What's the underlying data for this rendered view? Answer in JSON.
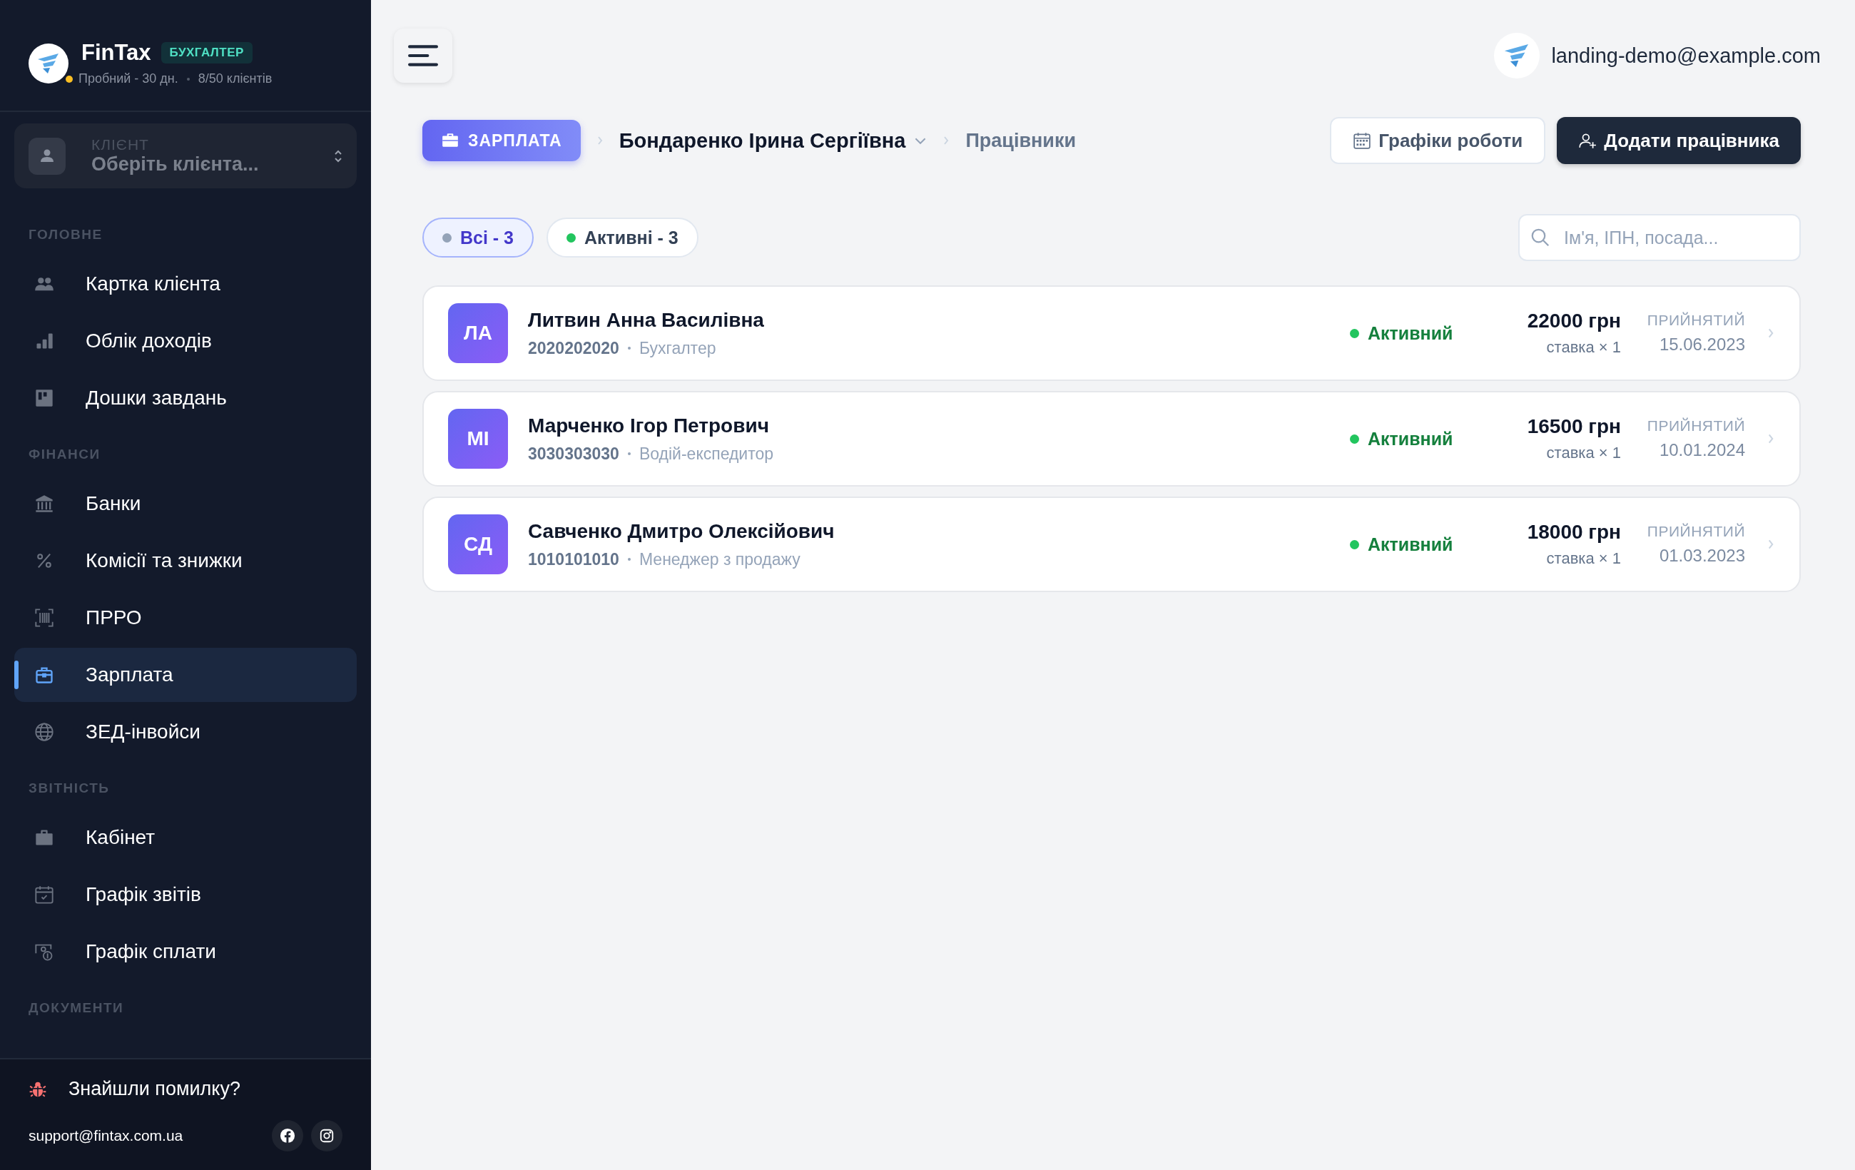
{
  "sidebar": {
    "brand": {
      "name": "FinTax",
      "badge": "БУХГАЛТЕР",
      "plan": "Пробний - 30 дн.",
      "clients": "8/50 клієнтів"
    },
    "client_select": {
      "label": "КЛІЄНТ",
      "placeholder": "Оберіть клієнта..."
    },
    "sections": [
      {
        "title": "ГОЛОВНЕ",
        "items": [
          {
            "label": "Картка клієнта",
            "selected": false
          },
          {
            "label": "Облік доходів",
            "selected": false
          },
          {
            "label": "Дошки завдань",
            "selected": false
          }
        ]
      },
      {
        "title": "ФІНАНСИ",
        "items": [
          {
            "label": "Банки",
            "selected": false
          },
          {
            "label": "Комісії та знижки",
            "selected": false
          },
          {
            "label": "ПРРО",
            "selected": false
          },
          {
            "label": "Зарплата",
            "selected": true
          },
          {
            "label": "ЗЕД-інвойси",
            "selected": false
          }
        ]
      },
      {
        "title": "ЗВІТНІСТЬ",
        "items": [
          {
            "label": "Кабінет",
            "selected": false
          },
          {
            "label": "Графік звітів",
            "selected": false
          },
          {
            "label": "Графік сплати",
            "selected": false
          }
        ]
      },
      {
        "title": "ДОКУМЕНТИ"
      }
    ],
    "footer": {
      "bug_report": "Знайшли помилку?",
      "email": "support@fintax.com.ua"
    }
  },
  "topbar": {
    "user_email": "landing-demo@example.com"
  },
  "breadcrumb": [
    {
      "label": "ЗАРПЛАТА",
      "kind": "module"
    },
    {
      "label": "Бондаренко Ірина Сергіївна",
      "kind": "dropdown"
    },
    {
      "label": "Працівники",
      "kind": "text"
    }
  ],
  "actions": [
    {
      "label": "Графіки роботи",
      "kind": "secondary"
    },
    {
      "label": "Додати працівника",
      "kind": "primary"
    }
  ],
  "filters": [
    {
      "label": "Всі - 3",
      "selected": true,
      "color": "#94a3b8"
    },
    {
      "label": "Активні - 3",
      "selected": false,
      "color": "#22c55e"
    }
  ],
  "search": {
    "placeholder": "Ім'я, ІПН, посада..."
  },
  "employees": [
    {
      "initials": "ЛА",
      "name": "Литвин Анна Василівна",
      "tax_id": "2020202020",
      "position": "Бухгалтер",
      "status": "Активний",
      "salary": "22000 грн",
      "rate": "ставка × 1",
      "hired_label": "ПРИЙНЯТИЙ",
      "hired_date": "15.06.2023"
    },
    {
      "initials": "МІ",
      "name": "Марченко Ігор Петрович",
      "tax_id": "3030303030",
      "position": "Водій-експедитор",
      "status": "Активний",
      "salary": "16500 грн",
      "rate": "ставка × 1",
      "hired_label": "ПРИЙНЯТИЙ",
      "hired_date": "10.01.2024"
    },
    {
      "initials": "СД",
      "name": "Савченко Дмитро Олексійович",
      "tax_id": "1010101010",
      "position": "Менеджер з продажу",
      "status": "Активний",
      "salary": "18000 грн",
      "rate": "ставка × 1",
      "hired_label": "ПРИЙНЯТИЙ",
      "hired_date": "01.03.2023"
    }
  ]
}
